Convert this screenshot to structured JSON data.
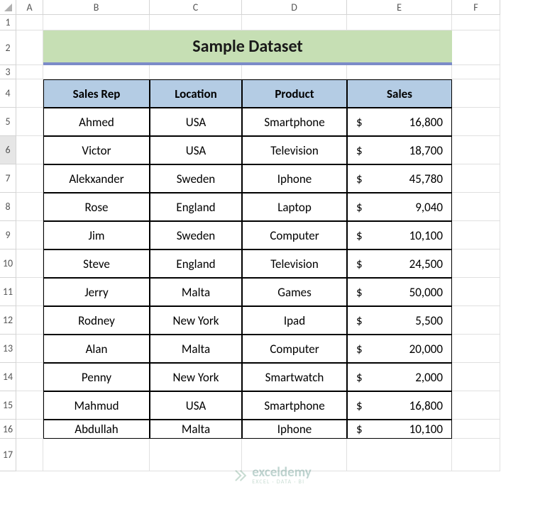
{
  "columns": [
    "A",
    "B",
    "C",
    "D",
    "E",
    "F"
  ],
  "rows": [
    "1",
    "2",
    "3",
    "4",
    "5",
    "6",
    "7",
    "8",
    "9",
    "10",
    "11",
    "12",
    "13",
    "14",
    "15",
    "16",
    "17"
  ],
  "activeRow": 6,
  "title": "Sample Dataset",
  "headers": [
    "Sales Rep",
    "Location",
    "Product",
    "Sales"
  ],
  "data": [
    {
      "rep": "Ahmed",
      "loc": "USA",
      "prod": "Smartphone",
      "sales": "16,800"
    },
    {
      "rep": "Victor",
      "loc": "USA",
      "prod": "Television",
      "sales": "18,700"
    },
    {
      "rep": "Alekxander",
      "loc": "Sweden",
      "prod": "Iphone",
      "sales": "45,780"
    },
    {
      "rep": "Rose",
      "loc": "England",
      "prod": "Laptop",
      "sales": "9,040"
    },
    {
      "rep": "Jim",
      "loc": "Sweden",
      "prod": "Computer",
      "sales": "10,100"
    },
    {
      "rep": "Steve",
      "loc": "England",
      "prod": "Television",
      "sales": "24,500"
    },
    {
      "rep": "Jerry",
      "loc": "Malta",
      "prod": "Games",
      "sales": "50,000"
    },
    {
      "rep": "Rodney",
      "loc": "New York",
      "prod": "Ipad",
      "sales": "5,500"
    },
    {
      "rep": "Alan",
      "loc": "Malta",
      "prod": "Computer",
      "sales": "20,000"
    },
    {
      "rep": "Penny",
      "loc": "New York",
      "prod": "Smartwatch",
      "sales": "2,000"
    },
    {
      "rep": "Mahmud",
      "loc": "USA",
      "prod": "Smartphone",
      "sales": "16,800"
    },
    {
      "rep": "Abdullah",
      "loc": "Malta",
      "prod": "Iphone",
      "sales": "10,100"
    }
  ],
  "currency": "$",
  "watermark": {
    "main": "exceldemy",
    "sub": "EXCEL · DATA · BI"
  }
}
